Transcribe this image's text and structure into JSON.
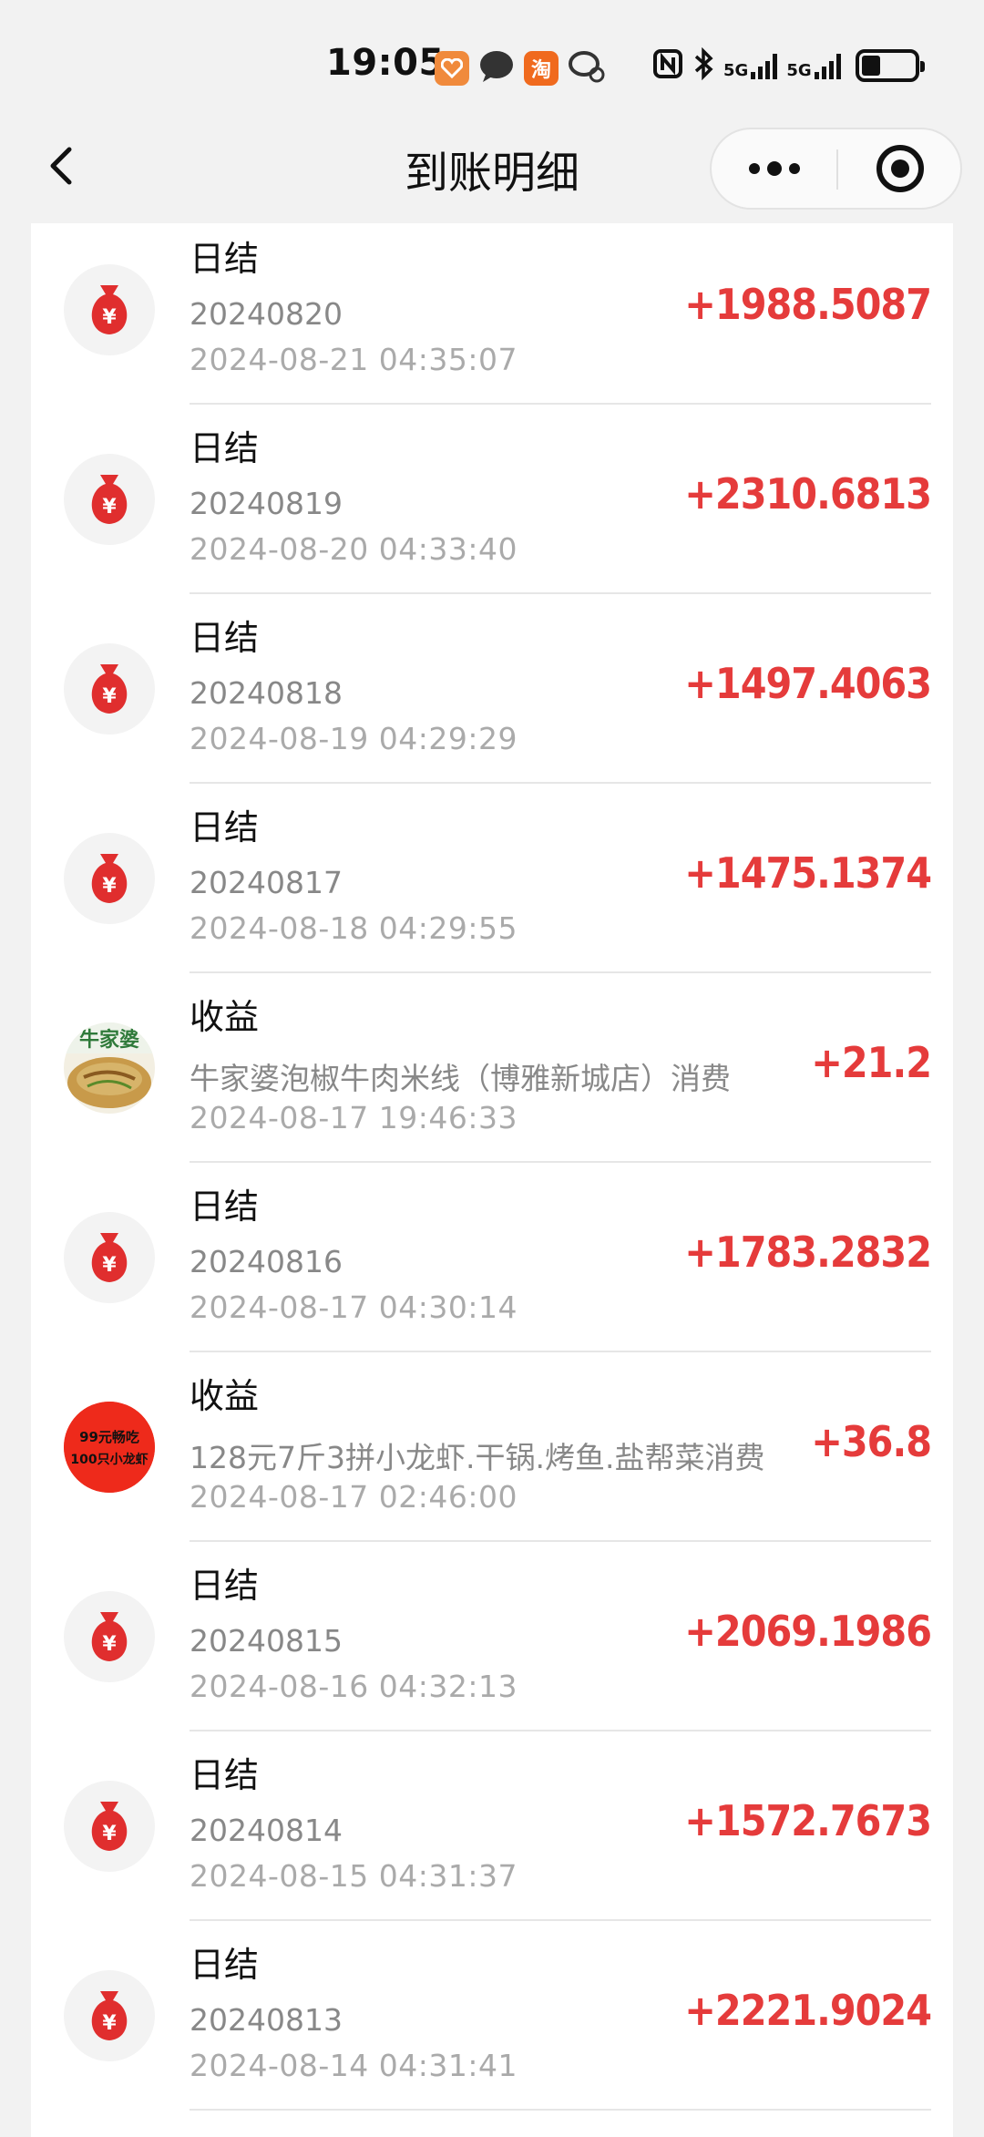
{
  "status": {
    "time": "19:05",
    "network1": "5G",
    "network2": "5G",
    "taobao_glyph": "淘"
  },
  "nav": {
    "title": "到账明细"
  },
  "icons": {
    "yuan": "¥"
  },
  "records": [
    {
      "title": "日结",
      "desc": "20240820",
      "time": "2024-08-21 04:35:07",
      "amount": "+1988.5087",
      "icon": "money-bag-icon"
    },
    {
      "title": "日结",
      "desc": "20240819",
      "time": "2024-08-20 04:33:40",
      "amount": "+2310.6813",
      "icon": "money-bag-icon"
    },
    {
      "title": "日结",
      "desc": "20240818",
      "time": "2024-08-19 04:29:29",
      "amount": "+1497.4063",
      "icon": "money-bag-icon"
    },
    {
      "title": "日结",
      "desc": "20240817",
      "time": "2024-08-18 04:29:55",
      "amount": "+1475.1374",
      "icon": "money-bag-icon"
    },
    {
      "title": "收益",
      "desc": "牛家婆泡椒牛肉米线（博雅新城店）消费",
      "time": "2024-08-17 19:46:33",
      "amount": "+21.2",
      "icon": "shop-thumbnail"
    },
    {
      "title": "日结",
      "desc": "20240816",
      "time": "2024-08-17 04:30:14",
      "amount": "+1783.2832",
      "icon": "money-bag-icon"
    },
    {
      "title": "收益",
      "desc": "128元7斤3拼小龙虾.干锅.烤鱼.盐帮菜消费",
      "time": "2024-08-17 02:46:00",
      "amount": "+36.8",
      "icon": "shop-thumbnail"
    },
    {
      "title": "日结",
      "desc": "20240815",
      "time": "2024-08-16 04:32:13",
      "amount": "+2069.1986",
      "icon": "money-bag-icon"
    },
    {
      "title": "日结",
      "desc": "20240814",
      "time": "2024-08-15 04:31:37",
      "amount": "+1572.7673",
      "icon": "money-bag-icon"
    },
    {
      "title": "日结",
      "desc": "20240813",
      "time": "2024-08-14 04:31:41",
      "amount": "+2221.9024",
      "icon": "money-bag-icon"
    }
  ],
  "thumbs": {
    "shop1_text": "牛家婆",
    "shop2_line1": "99元畅吃",
    "shop2_line2": "100只小龙虾"
  },
  "colors": {
    "amount": "#e53b3b",
    "bag": "#e02e2e"
  }
}
